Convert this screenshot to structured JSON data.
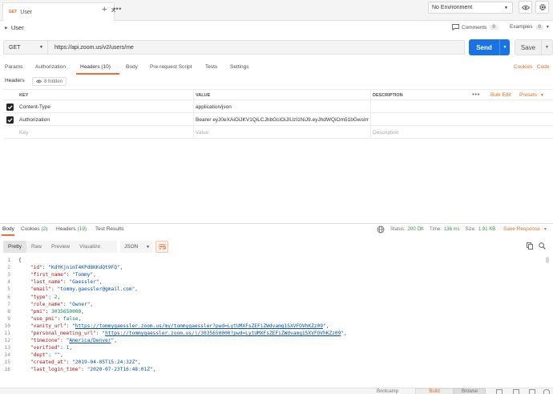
{
  "tabs": [
    {
      "method": "GET",
      "name": "User"
    }
  ],
  "environment": {
    "selected": "No Environment"
  },
  "request": {
    "title": "User",
    "comments_label": "Comments",
    "comments_count": "0",
    "examples_label": "Examples",
    "examples_count": "0",
    "method": "GET",
    "url": "https://api.zoom.us/v2/users/me",
    "send_label": "Send",
    "save_label": "Save"
  },
  "request_tabs": {
    "params": "Params",
    "authorization": "Authorization",
    "headers": "Headers (10)",
    "body": "Body",
    "prerequest": "Pre-request Script",
    "tests": "Tests",
    "settings": "Settings",
    "cookies": "Cookies",
    "code": "Code"
  },
  "headers_section": {
    "label": "Headers",
    "hidden_toggle": "8 hidden",
    "columns": {
      "key": "KEY",
      "value": "VALUE",
      "description": "DESCRIPTION"
    },
    "bulk_edit": "Bulk Edit",
    "presets": "Presets",
    "rows": [
      {
        "key": "Content-Type",
        "value": "application/json",
        "description": "",
        "checked": true
      },
      {
        "key": "Authorization",
        "value": "Bearer eyJ0eXAiOiJKV1QiLCJhbGciOiJIUzI1NiJ9.eyJhdWQiOm51bGwsIml...",
        "description": "",
        "checked": true
      }
    ],
    "placeholder": {
      "key": "Key",
      "value": "Value",
      "description": "Description"
    }
  },
  "response_tabs": {
    "body": "Body",
    "cookies": "Cookies",
    "cookies_count": "(2)",
    "headers": "Headers",
    "headers_count": "(19)",
    "test_results": "Test Results"
  },
  "response_status": {
    "status_label": "Status:",
    "status_value": "200 OK",
    "time_label": "Time:",
    "time_value": "136 ms",
    "size_label": "Size:",
    "size_value": "1.91 KB",
    "save_response": "Save Response"
  },
  "view_modes": {
    "pretty": "Pretty",
    "raw": "Raw",
    "preview": "Preview",
    "visualize": "Visualize",
    "format": "JSON"
  },
  "code_lines": [
    [
      {
        "t": "p",
        "v": "{"
      }
    ],
    [
      {
        "t": "p",
        "v": "    "
      },
      {
        "t": "k",
        "v": "\"id\""
      },
      {
        "t": "p",
        "v": ": "
      },
      {
        "t": "s",
        "v": "\"KdYKjnimT4KPd8KKdQt9FQ\""
      },
      {
        "t": "p",
        "v": ","
      }
    ],
    [
      {
        "t": "p",
        "v": "    "
      },
      {
        "t": "k",
        "v": "\"first_name\""
      },
      {
        "t": "p",
        "v": ": "
      },
      {
        "t": "s",
        "v": "\"Tommy\""
      },
      {
        "t": "p",
        "v": ","
      }
    ],
    [
      {
        "t": "p",
        "v": "    "
      },
      {
        "t": "k",
        "v": "\"last_name\""
      },
      {
        "t": "p",
        "v": ": "
      },
      {
        "t": "s",
        "v": "\"Gaessler\""
      },
      {
        "t": "p",
        "v": ","
      }
    ],
    [
      {
        "t": "p",
        "v": "    "
      },
      {
        "t": "k",
        "v": "\"email\""
      },
      {
        "t": "p",
        "v": ": "
      },
      {
        "t": "s",
        "v": "\"tommy.gaessler@gmail.com\""
      },
      {
        "t": "p",
        "v": ","
      }
    ],
    [
      {
        "t": "p",
        "v": "    "
      },
      {
        "t": "k",
        "v": "\"type\""
      },
      {
        "t": "p",
        "v": ": "
      },
      {
        "t": "n",
        "v": "2"
      },
      {
        "t": "p",
        "v": ","
      }
    ],
    [
      {
        "t": "p",
        "v": "    "
      },
      {
        "t": "k",
        "v": "\"role_name\""
      },
      {
        "t": "p",
        "v": ": "
      },
      {
        "t": "s",
        "v": "\"Owner\""
      },
      {
        "t": "p",
        "v": ","
      }
    ],
    [
      {
        "t": "p",
        "v": "    "
      },
      {
        "t": "k",
        "v": "\"pmi\""
      },
      {
        "t": "p",
        "v": ": "
      },
      {
        "t": "n",
        "v": "3035650000"
      },
      {
        "t": "p",
        "v": ","
      }
    ],
    [
      {
        "t": "p",
        "v": "    "
      },
      {
        "t": "k",
        "v": "\"use_pmi\""
      },
      {
        "t": "p",
        "v": ": "
      },
      {
        "t": "n",
        "v": "false"
      },
      {
        "t": "p",
        "v": ","
      }
    ],
    [
      {
        "t": "p",
        "v": "    "
      },
      {
        "t": "k",
        "v": "\"vanity_url\""
      },
      {
        "t": "p",
        "v": ": "
      },
      {
        "t": "s",
        "v": "\""
      },
      {
        "t": "l",
        "v": "https://tommygaessler.zoom.us/my/tommygaessler?pwd=LytUMXFsZEFiZWdvamg1SXVFOVhKZz09"
      },
      {
        "t": "s",
        "v": "\""
      },
      {
        "t": "p",
        "v": ","
      }
    ],
    [
      {
        "t": "p",
        "v": "    "
      },
      {
        "t": "k",
        "v": "\"personal_meeting_url\""
      },
      {
        "t": "p",
        "v": ": "
      },
      {
        "t": "s",
        "v": "\""
      },
      {
        "t": "l",
        "v": "https://tommygaessler.zoom.us/j/3035650000?pwd=LytUMXFsZEFiZWdvamg1SXVFOVhKZz09"
      },
      {
        "t": "s",
        "v": "\""
      },
      {
        "t": "p",
        "v": ","
      }
    ],
    [
      {
        "t": "p",
        "v": "    "
      },
      {
        "t": "k",
        "v": "\"timezone\""
      },
      {
        "t": "p",
        "v": ": "
      },
      {
        "t": "s",
        "v": "\""
      },
      {
        "t": "l",
        "v": "America/Denver"
      },
      {
        "t": "s",
        "v": "\""
      },
      {
        "t": "p",
        "v": ","
      }
    ],
    [
      {
        "t": "p",
        "v": "    "
      },
      {
        "t": "k",
        "v": "\"verified\""
      },
      {
        "t": "p",
        "v": ": "
      },
      {
        "t": "n",
        "v": "1"
      },
      {
        "t": "p",
        "v": ","
      }
    ],
    [
      {
        "t": "p",
        "v": "    "
      },
      {
        "t": "k",
        "v": "\"dept\""
      },
      {
        "t": "p",
        "v": ": "
      },
      {
        "t": "s",
        "v": "\"\""
      },
      {
        "t": "p",
        "v": ","
      }
    ],
    [
      {
        "t": "p",
        "v": "    "
      },
      {
        "t": "k",
        "v": "\"created_at\""
      },
      {
        "t": "p",
        "v": ": "
      },
      {
        "t": "s",
        "v": "\"2019-04-05T15:24:32Z\""
      },
      {
        "t": "p",
        "v": ","
      }
    ],
    [
      {
        "t": "p",
        "v": "    "
      },
      {
        "t": "k",
        "v": "\"last_login_time\""
      },
      {
        "t": "p",
        "v": ": "
      },
      {
        "t": "s",
        "v": "\"2020-07-23T16:48:01Z\""
      },
      {
        "t": "p",
        "v": ","
      }
    ]
  ],
  "statusbar": {
    "bootcamp": "Bootcamp",
    "build": "Build",
    "browse": "Browse"
  },
  "colors": {
    "accent": "#f26b3a",
    "send": "#1873e6",
    "link": "#e86c22",
    "status_ok": "#2f9d41"
  }
}
